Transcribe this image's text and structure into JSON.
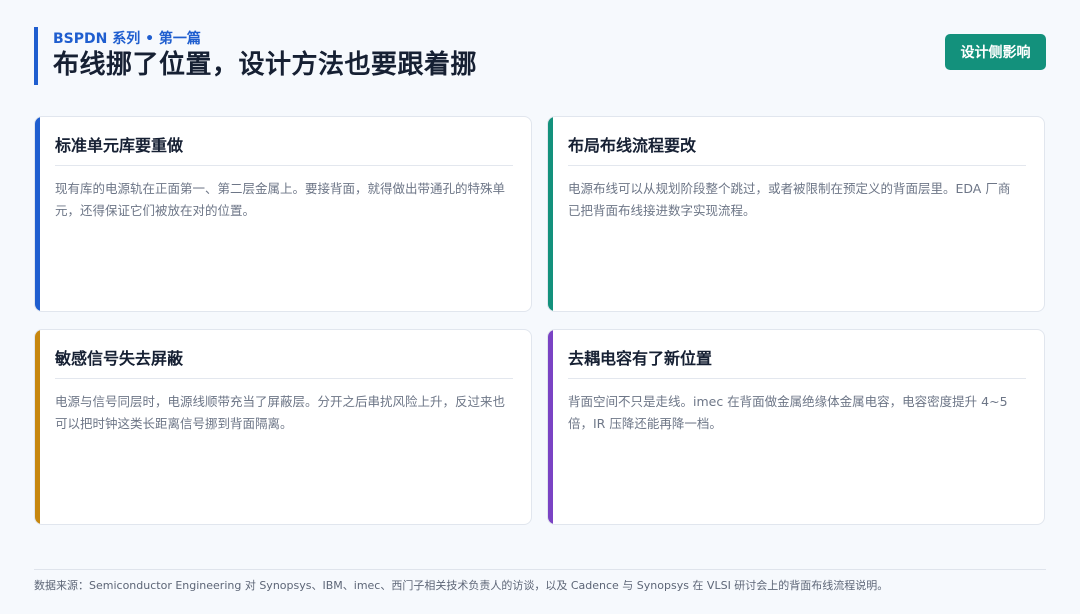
{
  "header": {
    "eyebrow": "BSPDN 系列 • 第一篇",
    "title": "布线挪了位置，设计方法也要跟着挪",
    "badge": "设计侧影响"
  },
  "colors": {
    "blue": "#1f5ecf",
    "teal": "#13917c",
    "amber": "#c7870f",
    "purple": "#7a43c4"
  },
  "cards": [
    {
      "title": "标准单元库要重做",
      "body": "现有库的电源轨在正面第一、第二层金属上。要接背面，就得做出带通孔的特殊单元，还得保证它们被放在对的位置。",
      "accent": "#1f5ecf"
    },
    {
      "title": "布局布线流程要改",
      "body": "电源布线可以从规划阶段整个跳过，或者被限制在预定义的背面层里。EDA 厂商已把背面布线接进数字实现流程。",
      "accent": "#13917c"
    },
    {
      "title": "敏感信号失去屏蔽",
      "body": "电源与信号同层时，电源线顺带充当了屏蔽层。分开之后串扰风险上升，反过来也可以把时钟这类长距离信号挪到背面隔离。",
      "accent": "#c7870f"
    },
    {
      "title": "去耦电容有了新位置",
      "body": "背面空间不只是走线。imec 在背面做金属绝缘体金属电容，电容密度提升 4~5 倍，IR 压降还能再降一档。",
      "accent": "#7a43c4"
    }
  ],
  "footer": {
    "source": "数据来源：Semiconductor Engineering 对 Synopsys、IBM、imec、西门子相关技术负责人的访谈，以及 Cadence 与 Synopsys 在 VLSI 研讨会上的背面布线流程说明。"
  }
}
